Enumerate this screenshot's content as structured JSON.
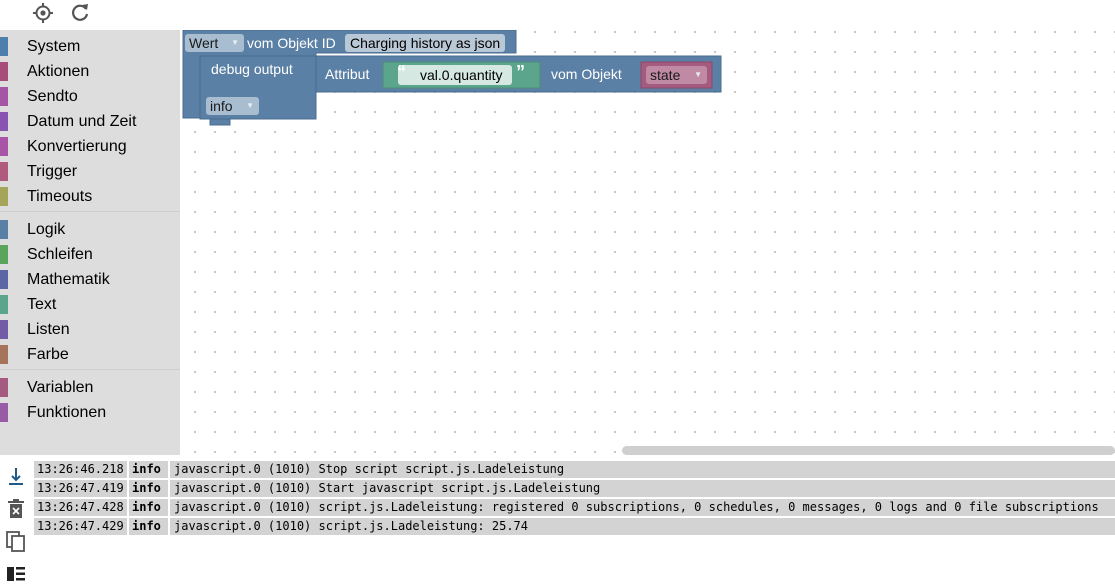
{
  "toolbar": {
    "icons": [
      "target-icon",
      "refresh-icon"
    ]
  },
  "toolbox": {
    "groups": [
      [
        {
          "label": "System",
          "color": "#4e7fac"
        },
        {
          "label": "Aktionen",
          "color": "#a64d7a"
        },
        {
          "label": "Sendto",
          "color": "#a655a6"
        },
        {
          "label": "Datum und Zeit",
          "color": "#8a53b1"
        },
        {
          "label": "Konvertierung",
          "color": "#a855a8"
        },
        {
          "label": "Trigger",
          "color": "#b05a7e"
        },
        {
          "label": "Timeouts",
          "color": "#a5a55a"
        }
      ],
      [
        {
          "label": "Logik",
          "color": "#5b80a5"
        },
        {
          "label": "Schleifen",
          "color": "#5ba55b"
        },
        {
          "label": "Mathematik",
          "color": "#5b67a5"
        },
        {
          "label": "Text",
          "color": "#5ba58c"
        },
        {
          "label": "Listen",
          "color": "#745ba5"
        },
        {
          "label": "Farbe",
          "color": "#a5745b"
        }
      ],
      [
        {
          "label": "Variablen",
          "color": "#a55b80"
        },
        {
          "label": "Funktionen",
          "color": "#995ba5"
        }
      ]
    ]
  },
  "blocks": {
    "outer": {
      "dropdown": "Wert",
      "label": "vom Objekt ID",
      "object_id": "Charging history as json"
    },
    "debug": {
      "label": "debug output",
      "level": "info"
    },
    "attribute": {
      "label": "Attribut",
      "text": "val.0.quantity",
      "from_label": "vom Objekt",
      "variable": "state"
    }
  },
  "log": {
    "entries": [
      {
        "time": "13:26:46.218",
        "severity": "info",
        "message": "javascript.0 (1010) Stop script script.js.Ladeleistung"
      },
      {
        "time": "13:26:47.419",
        "severity": "info",
        "message": "javascript.0 (1010) Start javascript script.js.Ladeleistung"
      },
      {
        "time": "13:26:47.428",
        "severity": "info",
        "message": "javascript.0 (1010) script.js.Ladeleistung: registered 0 subscriptions, 0 schedules, 0 messages, 0 logs and 0 file subscriptions"
      },
      {
        "time": "13:26:47.429",
        "severity": "info",
        "message": "javascript.0 (1010) script.js.Ladeleistung: 25.74"
      }
    ]
  },
  "colors": {
    "block_blue": "#5b80a5",
    "block_blue_dark": "#4a6d90",
    "text_block": "#5ba58c",
    "variable_block": "#a55b80"
  }
}
